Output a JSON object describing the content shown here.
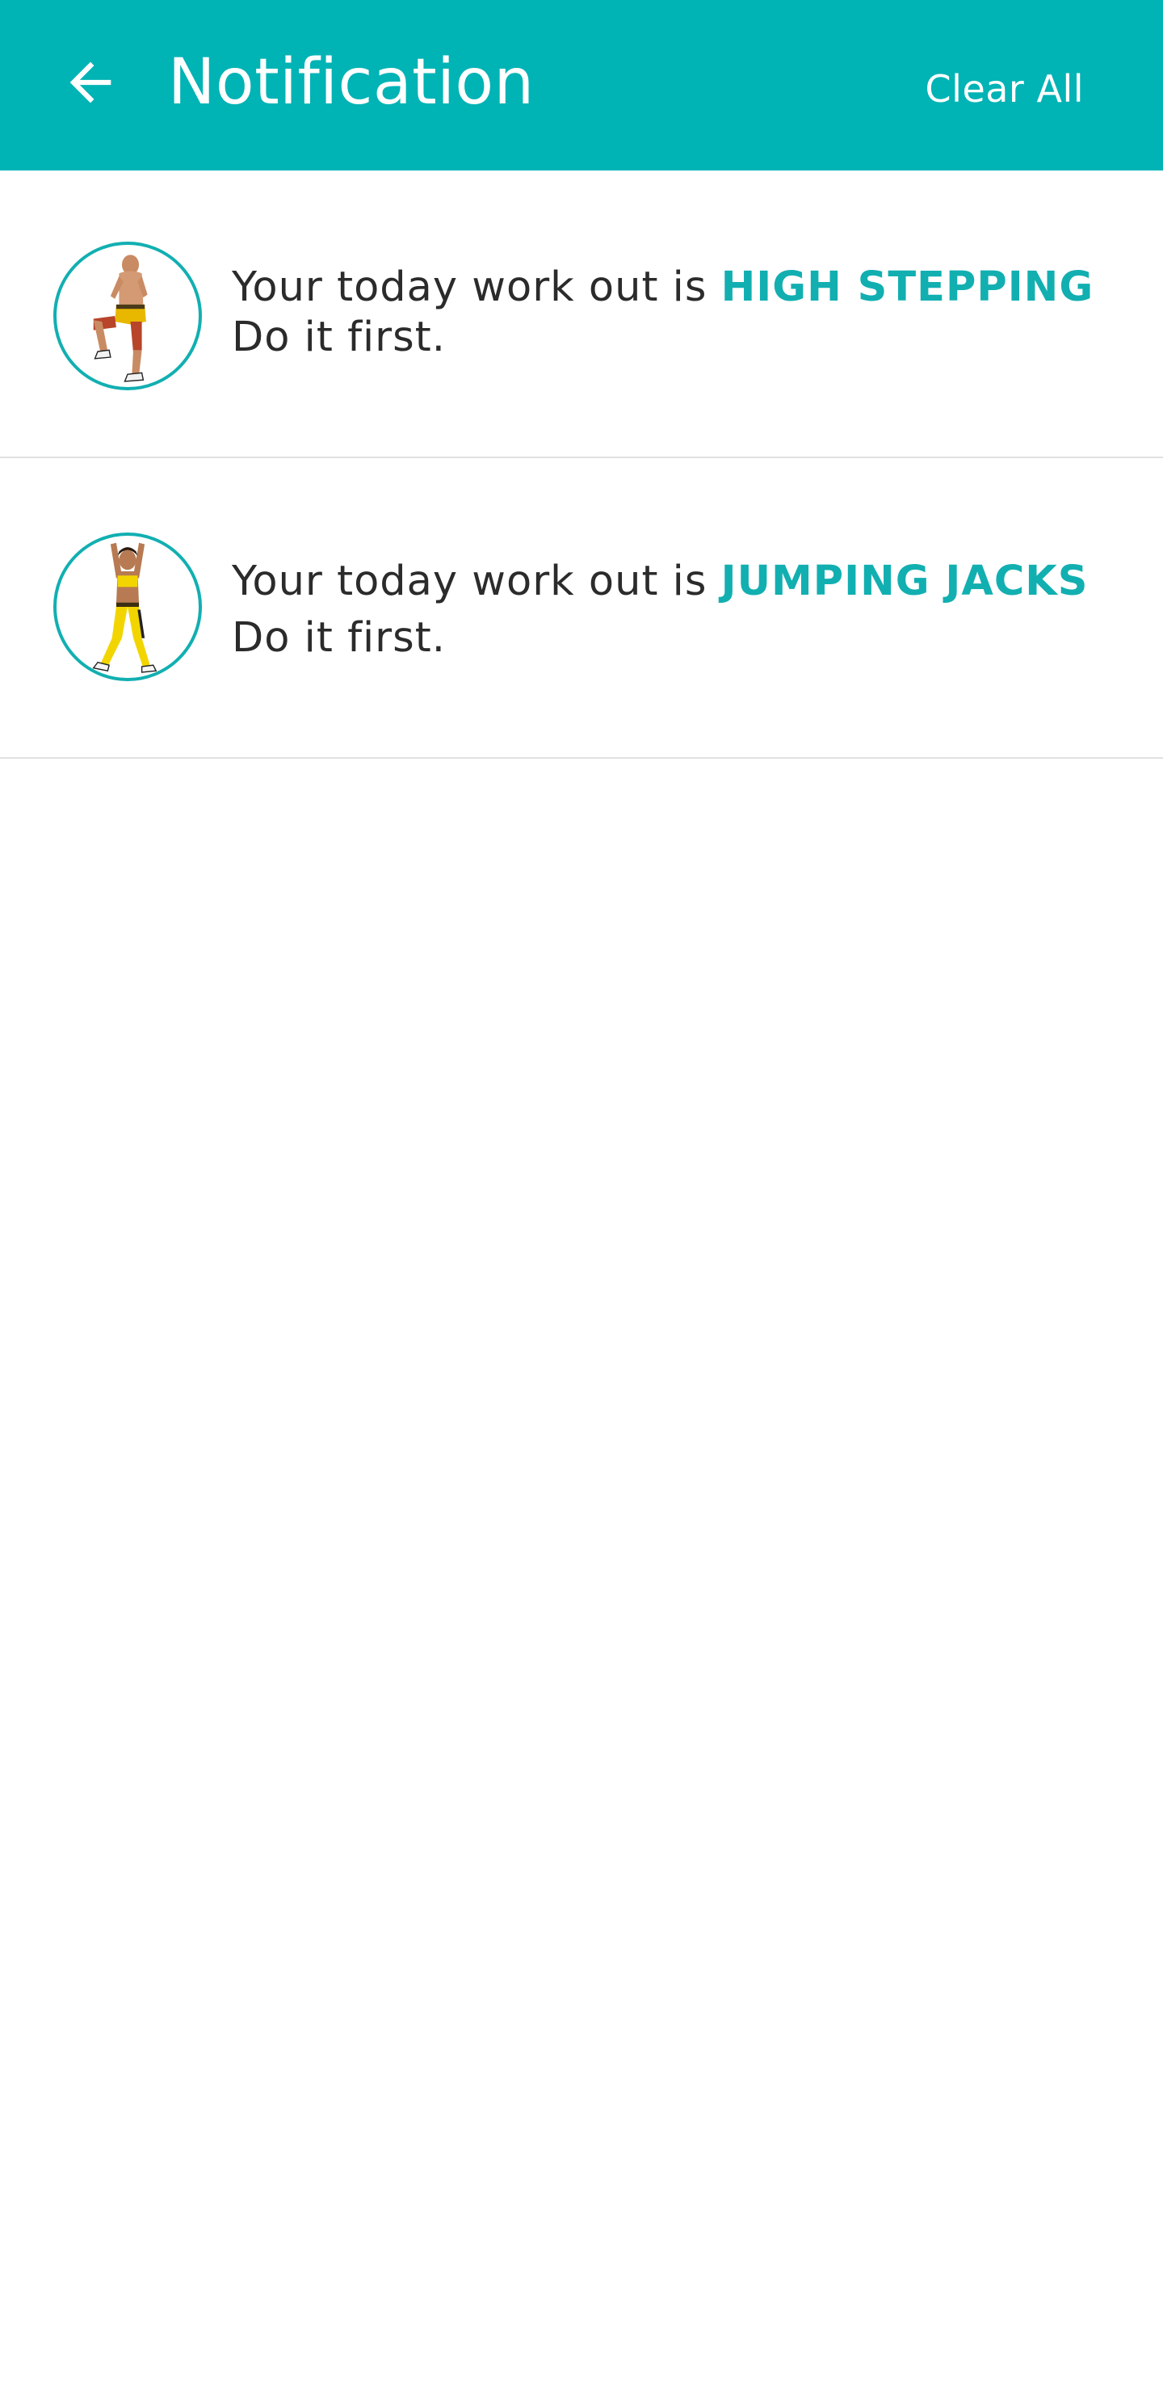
{
  "header": {
    "title": "Notification",
    "clear_all_label": "Clear All",
    "back_icon": "arrow-left-icon",
    "background_color": "#00b3b5"
  },
  "notifications": [
    {
      "prefix": "Your today work out is",
      "workout": "HIGH STEPPING",
      "suffix": "Do it first.",
      "avatar_icon": "high-stepping-figure-icon"
    },
    {
      "prefix": "Your today work out is",
      "workout": "JUMPING JACKS",
      "suffix": "Do it first.",
      "avatar_icon": "jumping-jacks-figure-icon"
    }
  ],
  "colors": {
    "accent": "#12afb1",
    "text": "#2b2b2b",
    "divider": "#e1e1e1"
  }
}
